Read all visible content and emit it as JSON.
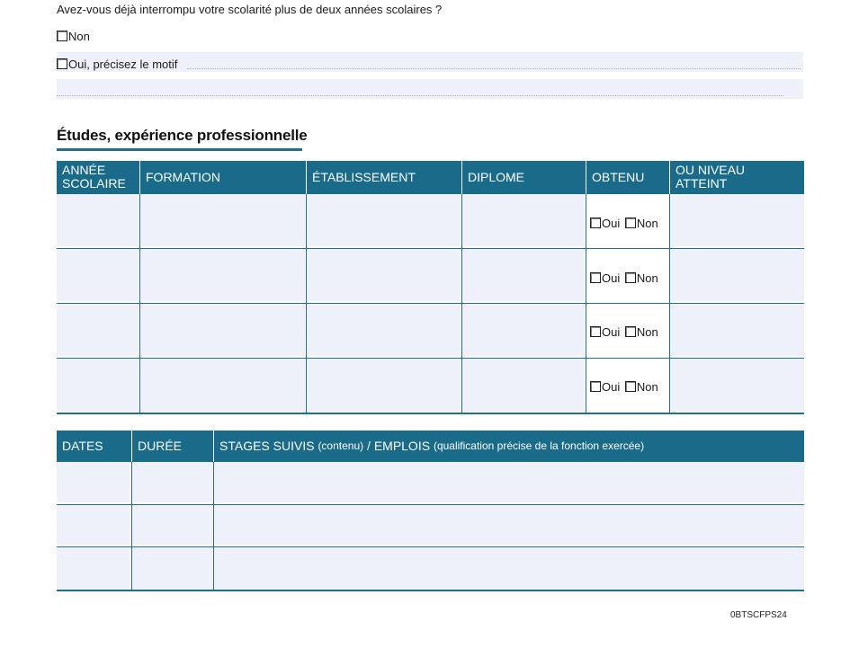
{
  "question": {
    "text": "Avez-vous déjà interrompu votre scolarité plus de deux années scolaires ?",
    "option_no": "Non",
    "option_yes": "Oui, précisez le motif"
  },
  "section": {
    "title": "Études, expérience professionnelle"
  },
  "studies_table": {
    "headers": [
      "ANNÉE\nSCOLAIRE",
      "FORMATION",
      "ÉTABLISSEMENT",
      "DIPLOME",
      "OBTENU",
      "OU NIVEAU\nATTEINT"
    ],
    "row_options": {
      "yes": "Oui",
      "no": "Non"
    },
    "row_count": 4
  },
  "experience_table": {
    "headers": {
      "dates": "DATES",
      "duree": "DURÉE",
      "stages_main": "STAGES SUIVIS",
      "stages_contenu": "(contenu)",
      "stages_sep": " / ",
      "emplois": "EMPLOIS",
      "emplois_detail": "(qualification précise de la fonction exercée)"
    },
    "row_count": 3
  },
  "footer": {
    "code": "0BTSCFPS24"
  },
  "colors": {
    "header_bg": "#1a6b8a",
    "field_bg": "#eef1fa",
    "rule": "#1f6e8c"
  }
}
